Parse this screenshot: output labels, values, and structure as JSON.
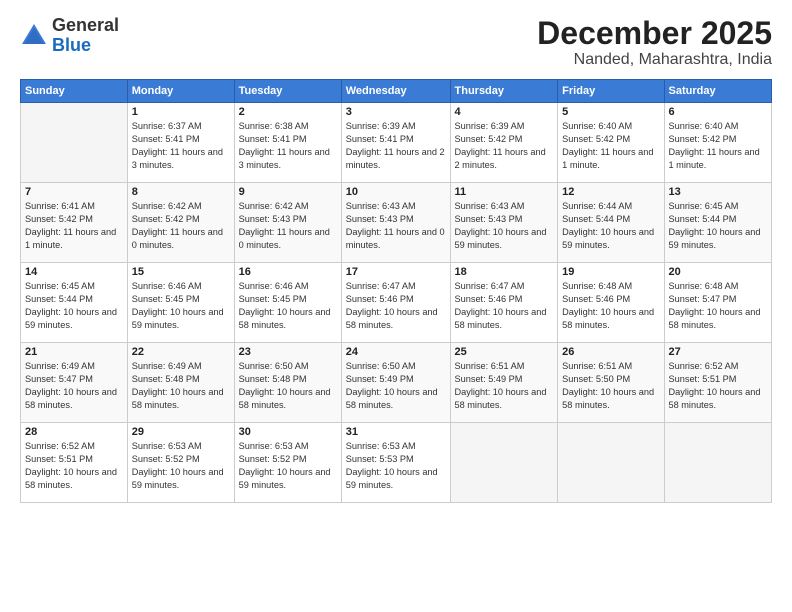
{
  "logo": {
    "general": "General",
    "blue": "Blue"
  },
  "title": "December 2025",
  "location": "Nanded, Maharashtra, India",
  "headers": [
    "Sunday",
    "Monday",
    "Tuesday",
    "Wednesday",
    "Thursday",
    "Friday",
    "Saturday"
  ],
  "weeks": [
    [
      {
        "day": "",
        "sunrise": "",
        "sunset": "",
        "daylight": ""
      },
      {
        "day": "1",
        "sunrise": "Sunrise: 6:37 AM",
        "sunset": "Sunset: 5:41 PM",
        "daylight": "Daylight: 11 hours and 3 minutes."
      },
      {
        "day": "2",
        "sunrise": "Sunrise: 6:38 AM",
        "sunset": "Sunset: 5:41 PM",
        "daylight": "Daylight: 11 hours and 3 minutes."
      },
      {
        "day": "3",
        "sunrise": "Sunrise: 6:39 AM",
        "sunset": "Sunset: 5:41 PM",
        "daylight": "Daylight: 11 hours and 2 minutes."
      },
      {
        "day": "4",
        "sunrise": "Sunrise: 6:39 AM",
        "sunset": "Sunset: 5:42 PM",
        "daylight": "Daylight: 11 hours and 2 minutes."
      },
      {
        "day": "5",
        "sunrise": "Sunrise: 6:40 AM",
        "sunset": "Sunset: 5:42 PM",
        "daylight": "Daylight: 11 hours and 1 minute."
      },
      {
        "day": "6",
        "sunrise": "Sunrise: 6:40 AM",
        "sunset": "Sunset: 5:42 PM",
        "daylight": "Daylight: 11 hours and 1 minute."
      }
    ],
    [
      {
        "day": "7",
        "sunrise": "Sunrise: 6:41 AM",
        "sunset": "Sunset: 5:42 PM",
        "daylight": "Daylight: 11 hours and 1 minute."
      },
      {
        "day": "8",
        "sunrise": "Sunrise: 6:42 AM",
        "sunset": "Sunset: 5:42 PM",
        "daylight": "Daylight: 11 hours and 0 minutes."
      },
      {
        "day": "9",
        "sunrise": "Sunrise: 6:42 AM",
        "sunset": "Sunset: 5:43 PM",
        "daylight": "Daylight: 11 hours and 0 minutes."
      },
      {
        "day": "10",
        "sunrise": "Sunrise: 6:43 AM",
        "sunset": "Sunset: 5:43 PM",
        "daylight": "Daylight: 11 hours and 0 minutes."
      },
      {
        "day": "11",
        "sunrise": "Sunrise: 6:43 AM",
        "sunset": "Sunset: 5:43 PM",
        "daylight": "Daylight: 10 hours and 59 minutes."
      },
      {
        "day": "12",
        "sunrise": "Sunrise: 6:44 AM",
        "sunset": "Sunset: 5:44 PM",
        "daylight": "Daylight: 10 hours and 59 minutes."
      },
      {
        "day": "13",
        "sunrise": "Sunrise: 6:45 AM",
        "sunset": "Sunset: 5:44 PM",
        "daylight": "Daylight: 10 hours and 59 minutes."
      }
    ],
    [
      {
        "day": "14",
        "sunrise": "Sunrise: 6:45 AM",
        "sunset": "Sunset: 5:44 PM",
        "daylight": "Daylight: 10 hours and 59 minutes."
      },
      {
        "day": "15",
        "sunrise": "Sunrise: 6:46 AM",
        "sunset": "Sunset: 5:45 PM",
        "daylight": "Daylight: 10 hours and 59 minutes."
      },
      {
        "day": "16",
        "sunrise": "Sunrise: 6:46 AM",
        "sunset": "Sunset: 5:45 PM",
        "daylight": "Daylight: 10 hours and 58 minutes."
      },
      {
        "day": "17",
        "sunrise": "Sunrise: 6:47 AM",
        "sunset": "Sunset: 5:46 PM",
        "daylight": "Daylight: 10 hours and 58 minutes."
      },
      {
        "day": "18",
        "sunrise": "Sunrise: 6:47 AM",
        "sunset": "Sunset: 5:46 PM",
        "daylight": "Daylight: 10 hours and 58 minutes."
      },
      {
        "day": "19",
        "sunrise": "Sunrise: 6:48 AM",
        "sunset": "Sunset: 5:46 PM",
        "daylight": "Daylight: 10 hours and 58 minutes."
      },
      {
        "day": "20",
        "sunrise": "Sunrise: 6:48 AM",
        "sunset": "Sunset: 5:47 PM",
        "daylight": "Daylight: 10 hours and 58 minutes."
      }
    ],
    [
      {
        "day": "21",
        "sunrise": "Sunrise: 6:49 AM",
        "sunset": "Sunset: 5:47 PM",
        "daylight": "Daylight: 10 hours and 58 minutes."
      },
      {
        "day": "22",
        "sunrise": "Sunrise: 6:49 AM",
        "sunset": "Sunset: 5:48 PM",
        "daylight": "Daylight: 10 hours and 58 minutes."
      },
      {
        "day": "23",
        "sunrise": "Sunrise: 6:50 AM",
        "sunset": "Sunset: 5:48 PM",
        "daylight": "Daylight: 10 hours and 58 minutes."
      },
      {
        "day": "24",
        "sunrise": "Sunrise: 6:50 AM",
        "sunset": "Sunset: 5:49 PM",
        "daylight": "Daylight: 10 hours and 58 minutes."
      },
      {
        "day": "25",
        "sunrise": "Sunrise: 6:51 AM",
        "sunset": "Sunset: 5:49 PM",
        "daylight": "Daylight: 10 hours and 58 minutes."
      },
      {
        "day": "26",
        "sunrise": "Sunrise: 6:51 AM",
        "sunset": "Sunset: 5:50 PM",
        "daylight": "Daylight: 10 hours and 58 minutes."
      },
      {
        "day": "27",
        "sunrise": "Sunrise: 6:52 AM",
        "sunset": "Sunset: 5:51 PM",
        "daylight": "Daylight: 10 hours and 58 minutes."
      }
    ],
    [
      {
        "day": "28",
        "sunrise": "Sunrise: 6:52 AM",
        "sunset": "Sunset: 5:51 PM",
        "daylight": "Daylight: 10 hours and 58 minutes."
      },
      {
        "day": "29",
        "sunrise": "Sunrise: 6:53 AM",
        "sunset": "Sunset: 5:52 PM",
        "daylight": "Daylight: 10 hours and 59 minutes."
      },
      {
        "day": "30",
        "sunrise": "Sunrise: 6:53 AM",
        "sunset": "Sunset: 5:52 PM",
        "daylight": "Daylight: 10 hours and 59 minutes."
      },
      {
        "day": "31",
        "sunrise": "Sunrise: 6:53 AM",
        "sunset": "Sunset: 5:53 PM",
        "daylight": "Daylight: 10 hours and 59 minutes."
      },
      {
        "day": "",
        "sunrise": "",
        "sunset": "",
        "daylight": ""
      },
      {
        "day": "",
        "sunrise": "",
        "sunset": "",
        "daylight": ""
      },
      {
        "day": "",
        "sunrise": "",
        "sunset": "",
        "daylight": ""
      }
    ]
  ]
}
